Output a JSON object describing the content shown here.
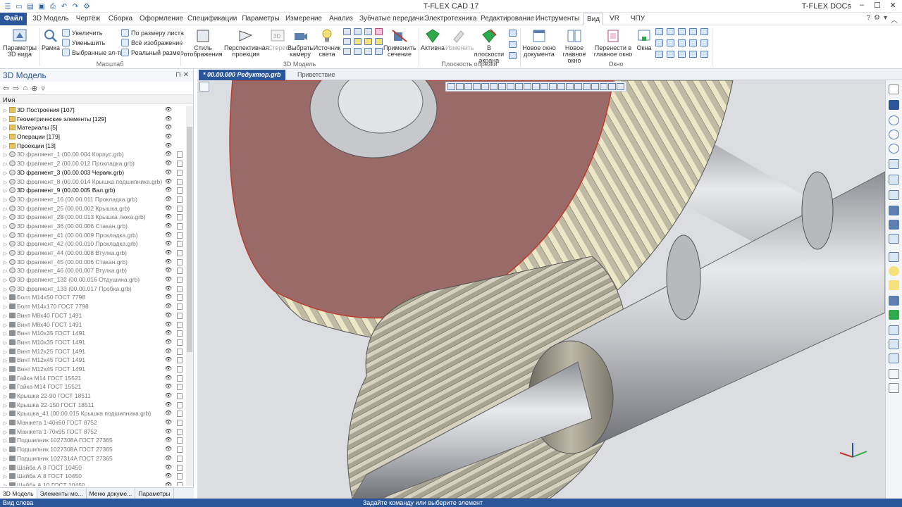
{
  "app": {
    "title": "T-FLEX CAD 17",
    "docs_label": "T-FLEX DOCs"
  },
  "menu": {
    "tabs": [
      "Файл",
      "3D Модель",
      "Чертёж",
      "Сборка",
      "Оформление",
      "Спецификации",
      "Параметры",
      "Измерение",
      "Анализ",
      "Зубчатые передачи",
      "Электротехника",
      "Редактирование",
      "Инструменты",
      "Вид",
      "VR",
      "ЧПУ"
    ],
    "active_tab": "Вид"
  },
  "ribbon": {
    "params_3d": "Параметры 3D вида",
    "frame": "Рамка",
    "zoom_in": "Увеличить",
    "zoom_out": "Уменьшить",
    "selected": "Выбранные эл-ты",
    "fit_sheet": "По размеру листа",
    "all_image": "Всё изображение",
    "real_size": "Реальный размер",
    "group_scale": "Масштаб",
    "display_style": "Стиль отображения",
    "perspective": "Перспективная проекция",
    "stereo": "Стерео",
    "choose_camera": "Выбрать камеру",
    "light_source": "Источник света",
    "apply_section": "Применить сечение",
    "group_3d": "3D Модель",
    "active": "Активна",
    "change": "Изменить",
    "in_screen_plane": "В плоскости экрана",
    "group_clip": "Плоскость обрезки",
    "new_doc_window": "Новое окно документа",
    "new_main_window": "Новое главное окно",
    "move_to_main": "Перенести в главное окно",
    "windows": "Окна",
    "group_window": "Окно"
  },
  "left_panel": {
    "title": "3D Модель",
    "column_name": "Имя",
    "items": [
      {
        "label": "3D Построения [107]",
        "type": "folder",
        "dark": true
      },
      {
        "label": "Геометрические элементы [129]",
        "type": "folder",
        "dark": true
      },
      {
        "label": "Материалы [5]",
        "type": "folder",
        "dark": true
      },
      {
        "label": "Операции [179]",
        "type": "folder",
        "dark": true
      },
      {
        "label": "Проекции [13]",
        "type": "folder",
        "dark": true
      },
      {
        "label": "3D фрагмент_1 (00.00.004 Корпус.grb)",
        "type": "frag",
        "dark": false
      },
      {
        "label": "3D фрагмент_2 (00.00.012 Прокладка.grb)",
        "type": "frag",
        "dark": false
      },
      {
        "label": "3D фрагмент_3 (00.00.003 Червяк.grb)",
        "type": "frag",
        "dark": true
      },
      {
        "label": "3D фрагмент_8 (00.00.014 Крышка подшипника.grb)",
        "type": "frag",
        "dark": false
      },
      {
        "label": "3D фрагмент_9 (00.00.005 Вал.grb)",
        "type": "frag",
        "dark": true
      },
      {
        "label": "3D фрагмент_16 (00.00.011 Прокладка.grb)",
        "type": "frag",
        "dark": false
      },
      {
        "label": "3D фрагмент_25 (00.00.002 Крышка.grb)",
        "type": "frag",
        "dark": false
      },
      {
        "label": "3D фрагмент_28 (00.00.013 Крышка люка.grb)",
        "type": "frag",
        "dark": false
      },
      {
        "label": "3D фрагмент_36 (00.00.006 Стакан.grb)",
        "type": "frag",
        "dark": false
      },
      {
        "label": "3D фрагмент_41 (00.00.009 Прокладка.grb)",
        "type": "frag",
        "dark": false
      },
      {
        "label": "3D фрагмент_42 (00.00.010 Прокладка.grb)",
        "type": "frag",
        "dark": false
      },
      {
        "label": "3D фрагмент_44 (00.00.008 Втулка.grb)",
        "type": "frag",
        "dark": false
      },
      {
        "label": "3D фрагмент_45 (00.00.006 Стакан.grb)",
        "type": "frag",
        "dark": false
      },
      {
        "label": "3D фрагмент_46 (00.00.007 Втулка.grb)",
        "type": "frag",
        "dark": false
      },
      {
        "label": "3D фрагмент_132 (00.00.016 Отдушина.grb)",
        "type": "frag",
        "dark": false
      },
      {
        "label": "3D фрагмент_133 (00.00.017 Пробка.grb)",
        "type": "frag",
        "dark": false
      },
      {
        "label": "Болт M14x50 ГОСТ 7798",
        "type": "std",
        "dark": false
      },
      {
        "label": "Болт M14x170 ГОСТ 7798",
        "type": "std",
        "dark": false
      },
      {
        "label": "Винт M8x40 ГОСТ 1491",
        "type": "std",
        "dark": false
      },
      {
        "label": "Винт M8x40 ГОСТ 1491",
        "type": "std",
        "dark": false
      },
      {
        "label": "Винт M10x35 ГОСТ 1491",
        "type": "std",
        "dark": false
      },
      {
        "label": "Винт M10x35 ГОСТ 1491",
        "type": "std",
        "dark": false
      },
      {
        "label": "Винт M12x25 ГОСТ 1491",
        "type": "std",
        "dark": false
      },
      {
        "label": "Винт M12x45 ГОСТ 1491",
        "type": "std",
        "dark": false
      },
      {
        "label": "Винт M12x45 ГОСТ 1491",
        "type": "std",
        "dark": false
      },
      {
        "label": "Гайка M14 ГОСТ 15521",
        "type": "std",
        "dark": false
      },
      {
        "label": "Гайка M14 ГОСТ 15521",
        "type": "std",
        "dark": false
      },
      {
        "label": "Крышка 22-90 ГОСТ 18511",
        "type": "std",
        "dark": false
      },
      {
        "label": "Крышка 22-150 ГОСТ 18511",
        "type": "std",
        "dark": false
      },
      {
        "label": "Крышка_41 (00.00.015 Крышка подшипника.grb)",
        "type": "std",
        "dark": false
      },
      {
        "label": "Манжета 1-40x60 ГОСТ 8752",
        "type": "std",
        "dark": false
      },
      {
        "label": "Манжета 1-70x95 ГОСТ 8752",
        "type": "std",
        "dark": false
      },
      {
        "label": "Подшипник 1027308A ГОСТ 27365",
        "type": "std",
        "dark": false
      },
      {
        "label": "Подшипник 1027308A ГОСТ 27365",
        "type": "std",
        "dark": false
      },
      {
        "label": "Подшипник 1027314A ГОСТ 27365",
        "type": "std",
        "dark": false
      },
      {
        "label": "Шайба А 8 ГОСТ 10450",
        "type": "std",
        "dark": false
      },
      {
        "label": "Шайба А 8 ГОСТ 10450",
        "type": "std",
        "dark": false
      },
      {
        "label": "Шайба А 10 ГОСТ 10450",
        "type": "std",
        "dark": false
      }
    ],
    "tabs": [
      "3D Модель",
      "Элементы мо...",
      "Меню докуме...",
      "Параметры"
    ]
  },
  "doc_tabs": [
    {
      "label": "* 00.00.000 Редуктор.grb",
      "active": true
    },
    {
      "label": "Приветствие",
      "active": false
    }
  ],
  "status": {
    "left": "Вид слева",
    "center": "Задайте команду или выберите элемент"
  },
  "colors": {
    "accent": "#2b579a",
    "section": "#9a6a68",
    "gear": "#c8c3ae",
    "shaft": "#b5b8bd"
  }
}
